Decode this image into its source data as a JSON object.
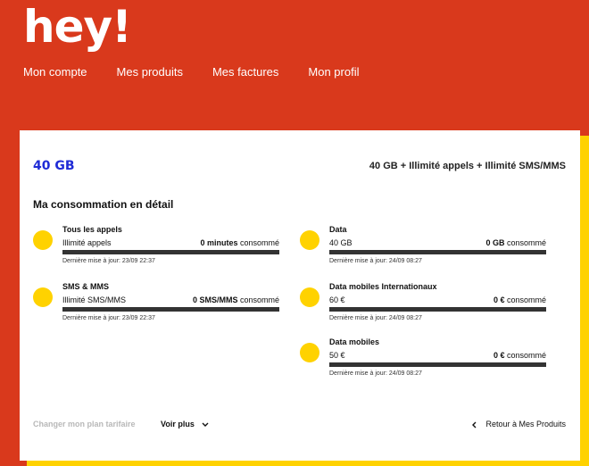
{
  "brand": {
    "logo_text": "hey!"
  },
  "nav": [
    {
      "label": "Mon compte"
    },
    {
      "label": "Mes produits"
    },
    {
      "label": "Mes factures"
    },
    {
      "label": "Mon profil"
    }
  ],
  "plan": {
    "size": "40 GB",
    "description": "40 GB + Illimité appels + Illimité SMS/MMS"
  },
  "section_title": "Ma consommation en détail",
  "left_items": [
    {
      "title": "Tous les appels",
      "allowance": "Illimité appels",
      "used_value": "0 minutes",
      "used_suffix": " consommé",
      "updated": "Dernière mise à jour: 23/09 22:37"
    },
    {
      "title": "SMS & MMS",
      "allowance": "Illimité SMS/MMS",
      "used_value": "0 SMS/MMS",
      "used_suffix": " consommé",
      "updated": "Dernière mise à jour: 23/09 22:37"
    }
  ],
  "right_items": [
    {
      "title": "Data",
      "allowance": "40 GB",
      "used_value": "0 GB",
      "used_suffix": " consommé",
      "updated": "Dernière mise à jour: 24/09 08:27"
    },
    {
      "title": "Data mobiles Internationaux",
      "allowance": "60 €",
      "used_value": "0 €",
      "used_suffix": " consommé",
      "updated": "Dernière mise à jour: 24/09 08:27"
    },
    {
      "title": "Data mobiles",
      "allowance": "50 €",
      "used_value": "0 €",
      "used_suffix": " consommé",
      "updated": "Dernière mise à jour: 24/09 08:27"
    }
  ],
  "footer": {
    "change_plan": "Changer mon plan tarifaire",
    "voir_plus": "Voir plus",
    "retour": "Retour à Mes Produits"
  },
  "icons": {
    "voir_plus_chevron": "chevron-down-icon",
    "retour_chevron": "chevron-left-icon"
  },
  "colors": {
    "background": "#d9391c",
    "accent_yellow": "#ffd200",
    "plan_blue": "#1f2bd6"
  }
}
